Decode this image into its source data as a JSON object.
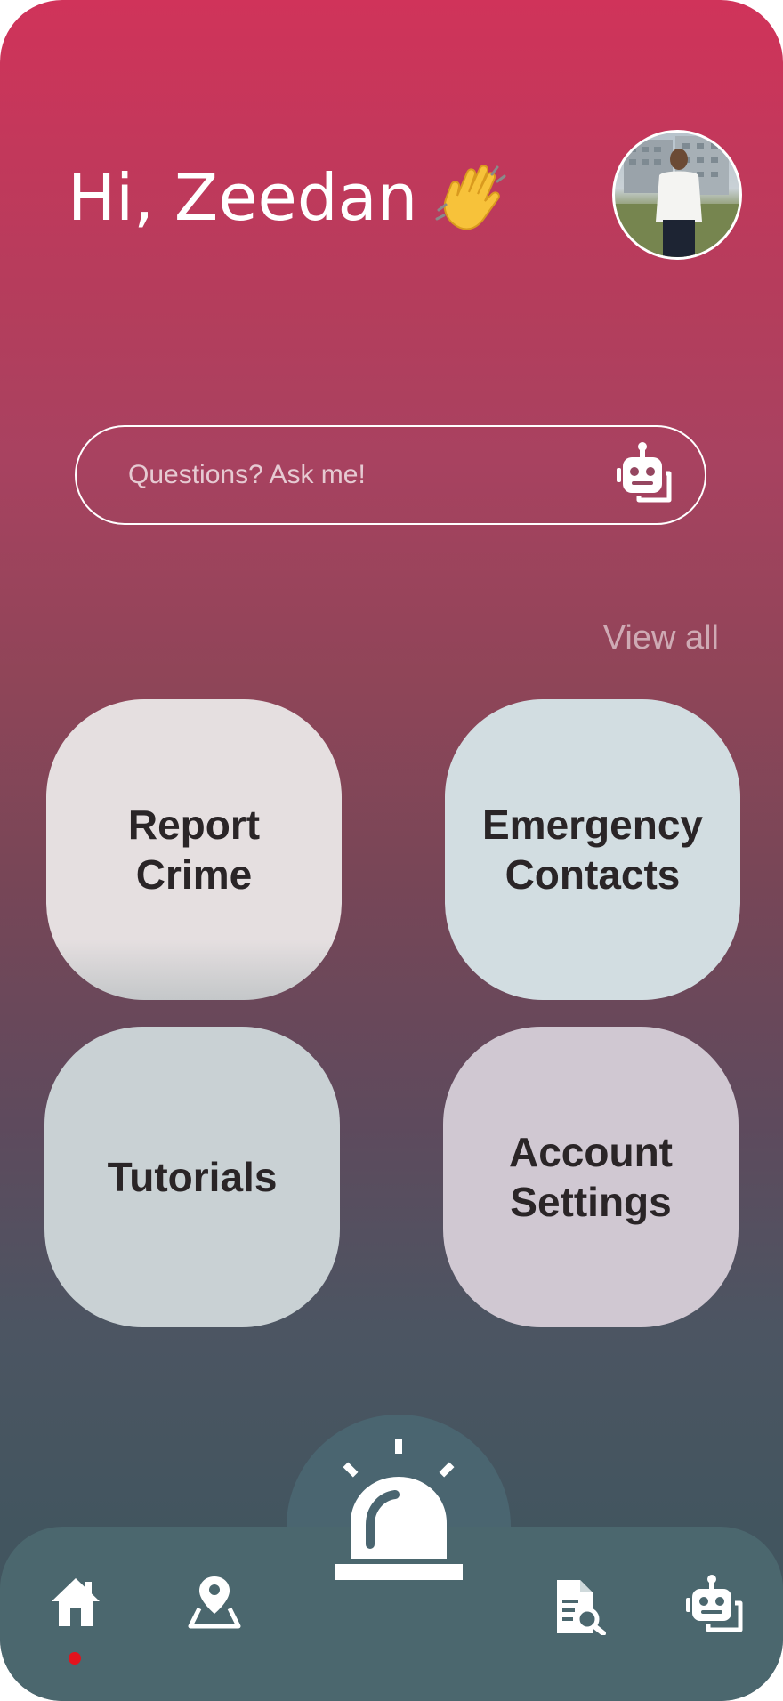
{
  "header": {
    "greeting": "Hi, Zeedan",
    "greeting_emoji": "waving-hand-icon"
  },
  "search": {
    "placeholder": "Questions? Ask me!",
    "icon": "robot-chat-icon"
  },
  "quick_actions": {
    "view_all_label": "View all",
    "tiles": [
      {
        "lines": [
          "Report",
          "Crime"
        ],
        "color": "#e5dfe0"
      },
      {
        "lines": [
          "Emergency",
          "Contacts"
        ],
        "color": "#d2dde1"
      },
      {
        "lines": [
          "Tutorials"
        ],
        "color": "#c9d1d4"
      },
      {
        "lines": [
          "Account",
          "Settings"
        ],
        "color": "#d0c8d2"
      }
    ]
  },
  "bottom_nav": {
    "items": [
      {
        "icon": "home-icon",
        "active": true
      },
      {
        "icon": "map-pin-icon",
        "active": false
      },
      {
        "icon": "alarm-siren-icon",
        "active": false
      },
      {
        "icon": "document-search-icon",
        "active": false
      },
      {
        "icon": "robot-chat-icon",
        "active": false
      }
    ],
    "active_indicator_color": "#e3131d"
  },
  "colors": {
    "gradient_top": "#d0335a",
    "gradient_bottom": "#42555f",
    "nav_bar": "#4b676e"
  }
}
